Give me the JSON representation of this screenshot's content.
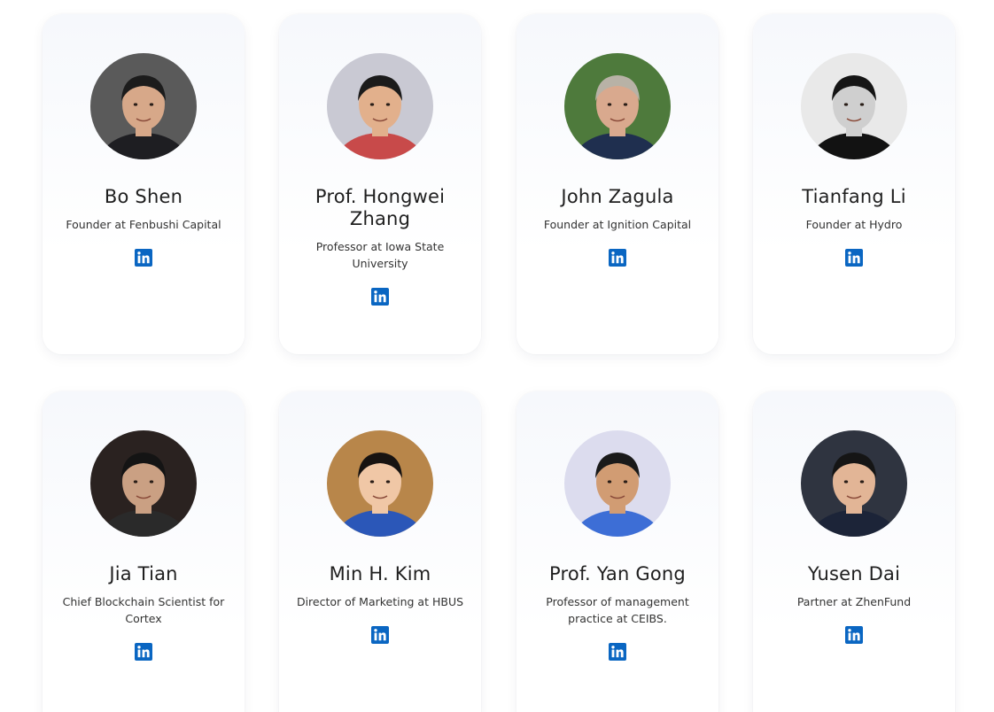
{
  "team": [
    {
      "name": "Bo Shen",
      "role": "Founder at Fenbushi Capital",
      "social_icon": "linkedin-icon",
      "portrait": {
        "bg": "#5a5a5a",
        "skin": "#d7a889",
        "hair": "#1c1c1c",
        "shirt": "#1e1e22"
      }
    },
    {
      "name": "Prof. Hongwei Zhang",
      "role": "Professor at Iowa State University",
      "social_icon": "linkedin-icon",
      "portrait": {
        "bg": "#c9c9d3",
        "skin": "#e2b08c",
        "hair": "#1b1b1b",
        "shirt": "#c84a4a"
      }
    },
    {
      "name": "John Zagula",
      "role": "Founder at Ignition Capital",
      "social_icon": "linkedin-icon",
      "portrait": {
        "bg": "#4e7a3c",
        "skin": "#d9a98e",
        "hair": "#b8b2a6",
        "shirt": "#1f2f4f"
      }
    },
    {
      "name": "Tianfang Li",
      "role": "Founder at Hydro",
      "social_icon": "linkedin-icon",
      "portrait": {
        "bg": "#e9e9e9",
        "skin": "#cfcfcf",
        "hair": "#151515",
        "shirt": "#121212"
      }
    },
    {
      "name": "Jia Tian",
      "role": "Chief Blockchain Scientist for Cortex",
      "social_icon": "linkedin-icon",
      "portrait": {
        "bg": "#2a2220",
        "skin": "#caa083",
        "hair": "#141414",
        "shirt": "#2a2a2a"
      }
    },
    {
      "name": "Min H. Kim",
      "role": "Director of Marketing at HBUS",
      "social_icon": "linkedin-icon",
      "portrait": {
        "bg": "#b8864a",
        "skin": "#f0c7a6",
        "hair": "#171311",
        "shirt": "#2b57b8"
      }
    },
    {
      "name": "Prof. Yan Gong",
      "role": "Professor of management practice at CEIBS.",
      "social_icon": "linkedin-icon",
      "portrait": {
        "bg": "#dcdcee",
        "skin": "#d19c73",
        "hair": "#1a1a1a",
        "shirt": "#3d6ed6"
      }
    },
    {
      "name": "Yusen Dai",
      "role": "Partner at ZhenFund",
      "social_icon": "linkedin-icon",
      "portrait": {
        "bg": "#2f3440",
        "skin": "#e2b596",
        "hair": "#151515",
        "shirt": "#1c2438"
      }
    }
  ],
  "colors": {
    "linkedin": "#0a66c2",
    "name_text": "#1f1f1f",
    "role_text": "#333333"
  }
}
